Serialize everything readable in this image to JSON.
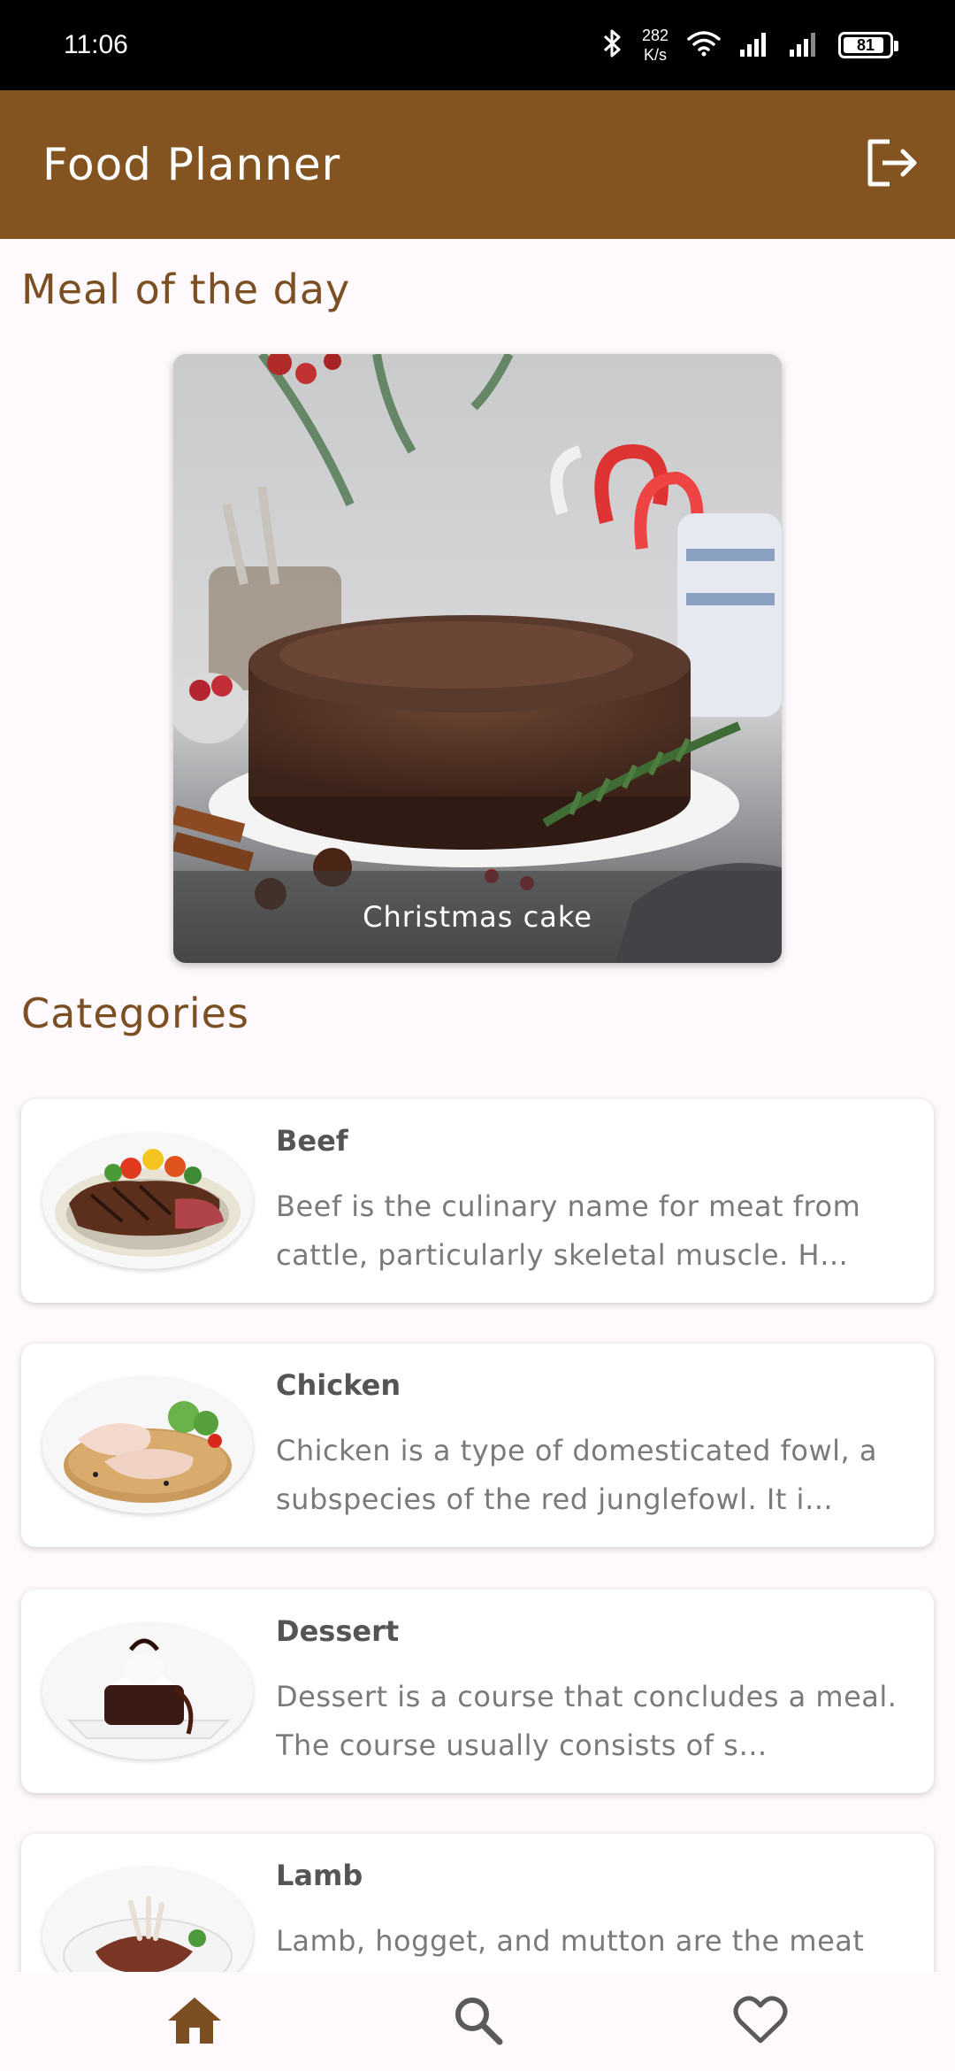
{
  "status_bar": {
    "time": "11:06",
    "net_speed_value": "282",
    "net_speed_unit": "K/s",
    "battery": "81",
    "icons": [
      "bluetooth-icon",
      "wifi-icon",
      "signal-icon",
      "signal-icon",
      "battery-icon"
    ]
  },
  "app_bar": {
    "title": "Food Planner",
    "logout_icon": "logout-icon"
  },
  "meal_of_day": {
    "section_title": "Meal of the day",
    "meal_name": "Christmas cake"
  },
  "categories": {
    "section_title": "Categories",
    "items": [
      {
        "name": "Beef",
        "description": "Beef is the culinary name for meat from cattle, particularly skeletal muscle. H…"
      },
      {
        "name": "Chicken",
        "description": "Chicken is a type of domesticated fowl, a subspecies of the red junglefowl. It i…"
      },
      {
        "name": "Dessert",
        "description": "Dessert is a course that concludes a meal. The course usually consists of s…"
      },
      {
        "name": "Lamb",
        "description": "Lamb, hogget, and mutton are the meat"
      }
    ]
  },
  "bottom_nav": {
    "items": [
      "home-icon",
      "search-icon",
      "favorite-icon"
    ],
    "active": "home-icon",
    "active_color": "#7b4f21",
    "inactive_color": "#5a5a5a"
  },
  "colors": {
    "primary": "#835320",
    "accent_text": "#7b4f21",
    "background": "#fdf9fd"
  }
}
